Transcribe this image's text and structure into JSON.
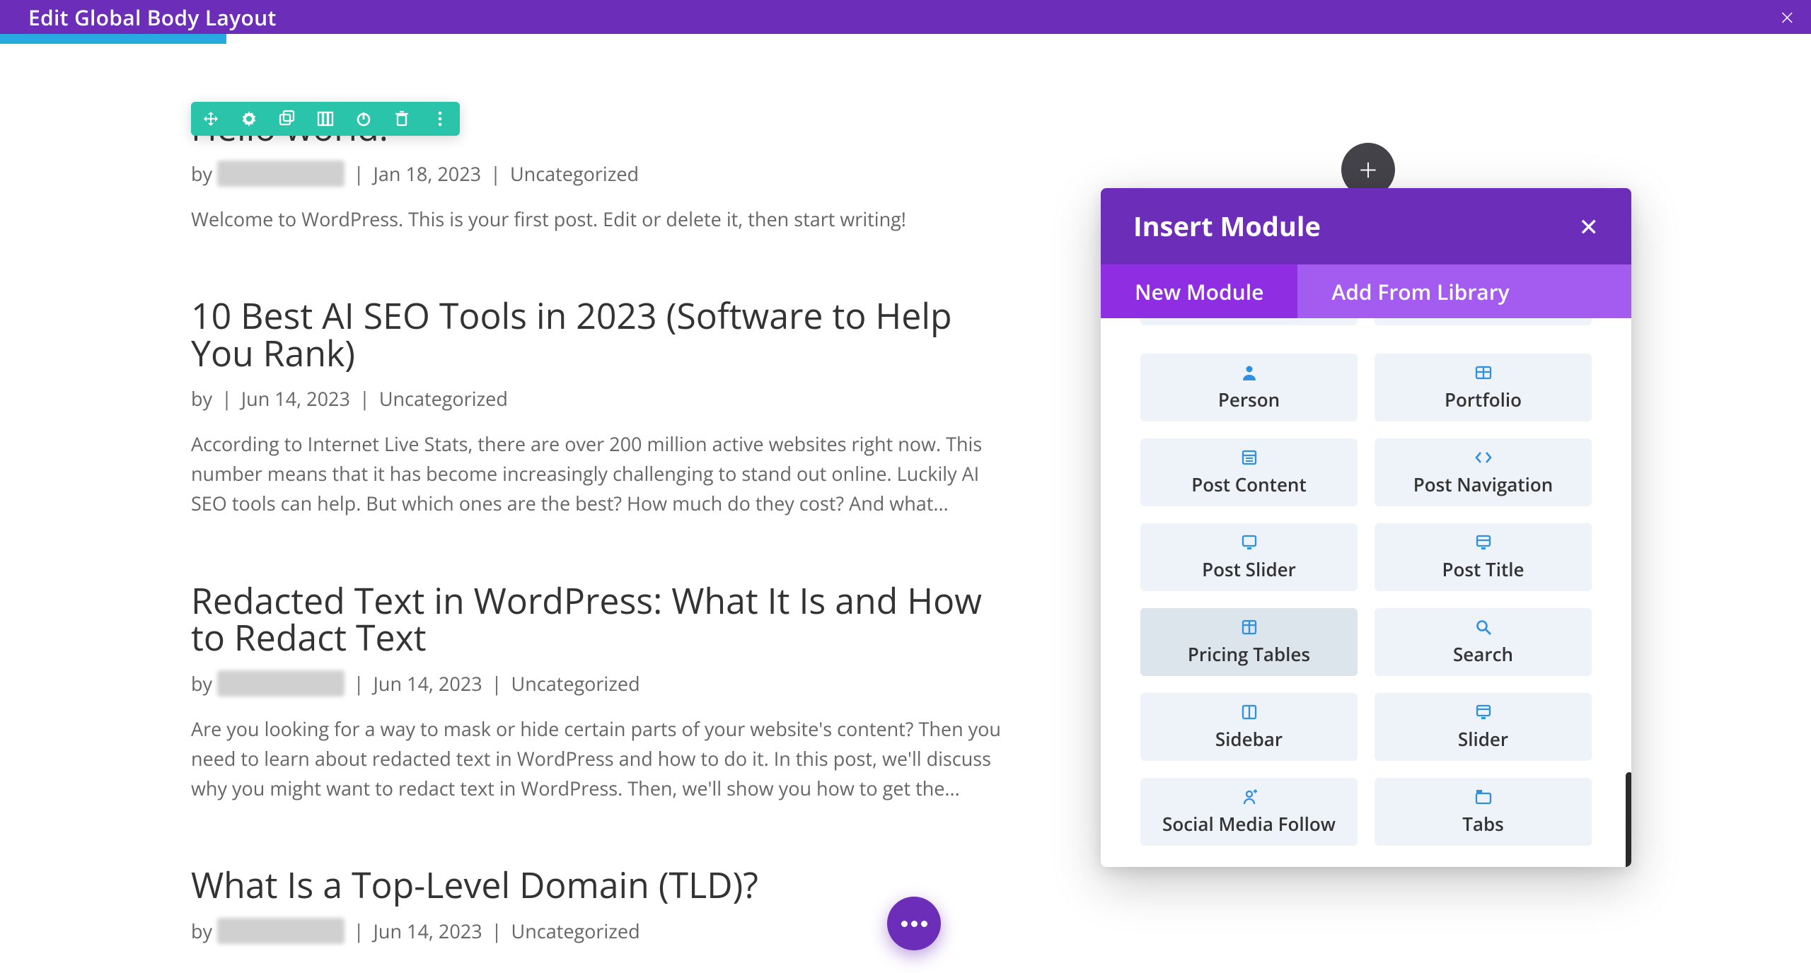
{
  "topbar": {
    "title": "Edit Global Body Layout"
  },
  "posts": [
    {
      "title": "Hello world!",
      "author_redacted": "hellooworldee",
      "date": "Jan 18, 2023",
      "category": "Uncategorized",
      "body": "Welcome to WordPress. This is your first post. Edit or delete it, then start writing!"
    },
    {
      "title": "10 Best AI SEO Tools in 2023 (Software to Help You Rank)",
      "author_redacted": "",
      "date": "Jun 14, 2023",
      "category": "Uncategorized",
      "body": "According to Internet Live Stats, there are over 200 million active websites right now. This number means that it has become increasingly challenging to stand out online. Luckily AI SEO tools can help. But which ones are the best? How much do they cost? And what..."
    },
    {
      "title": "Redacted Text in WordPress: What It Is and How to Redact Text",
      "author_redacted": "hellooworldee",
      "date": "Jun 14, 2023",
      "category": "Uncategorized",
      "body": "Are you looking for a way to mask or hide certain parts of your website's content? Then you need to learn about redacted text in WordPress and how to do it. In this post, we'll discuss why you might want to redact text in WordPress. Then, we'll show you how to get the..."
    },
    {
      "title": "What Is a Top-Level Domain (TLD)?",
      "author_redacted": "hellooworldee",
      "date": "Jun 14, 2023",
      "category": "Uncategorized",
      "body": ""
    }
  ],
  "by_label": "by",
  "sep": "|",
  "modal": {
    "title": "Insert Module",
    "tabs": {
      "new": "New Module",
      "library": "Add From Library"
    },
    "modules": [
      {
        "icon": "person",
        "label": "Person"
      },
      {
        "icon": "portfolio",
        "label": "Portfolio"
      },
      {
        "icon": "post-content",
        "label": "Post Content"
      },
      {
        "icon": "post-navigation",
        "label": "Post Navigation"
      },
      {
        "icon": "post-slider",
        "label": "Post Slider"
      },
      {
        "icon": "post-title",
        "label": "Post Title"
      },
      {
        "icon": "pricing-tables",
        "label": "Pricing Tables",
        "hover": true
      },
      {
        "icon": "search",
        "label": "Search"
      },
      {
        "icon": "sidebar",
        "label": "Sidebar"
      },
      {
        "icon": "slider",
        "label": "Slider"
      },
      {
        "icon": "social",
        "label": "Social Media Follow"
      },
      {
        "icon": "tabs",
        "label": "Tabs"
      }
    ]
  },
  "colors": {
    "brand_purple": "#6C2EB9",
    "tab_purple_light": "#A45BF0",
    "tab_purple_active": "#8E2DE2",
    "blue_accent": "#29A9E1",
    "toolbar_teal": "#29C4A9",
    "module_icon_blue": "#2F8FE0",
    "card_bg": "#EDF3F9"
  }
}
